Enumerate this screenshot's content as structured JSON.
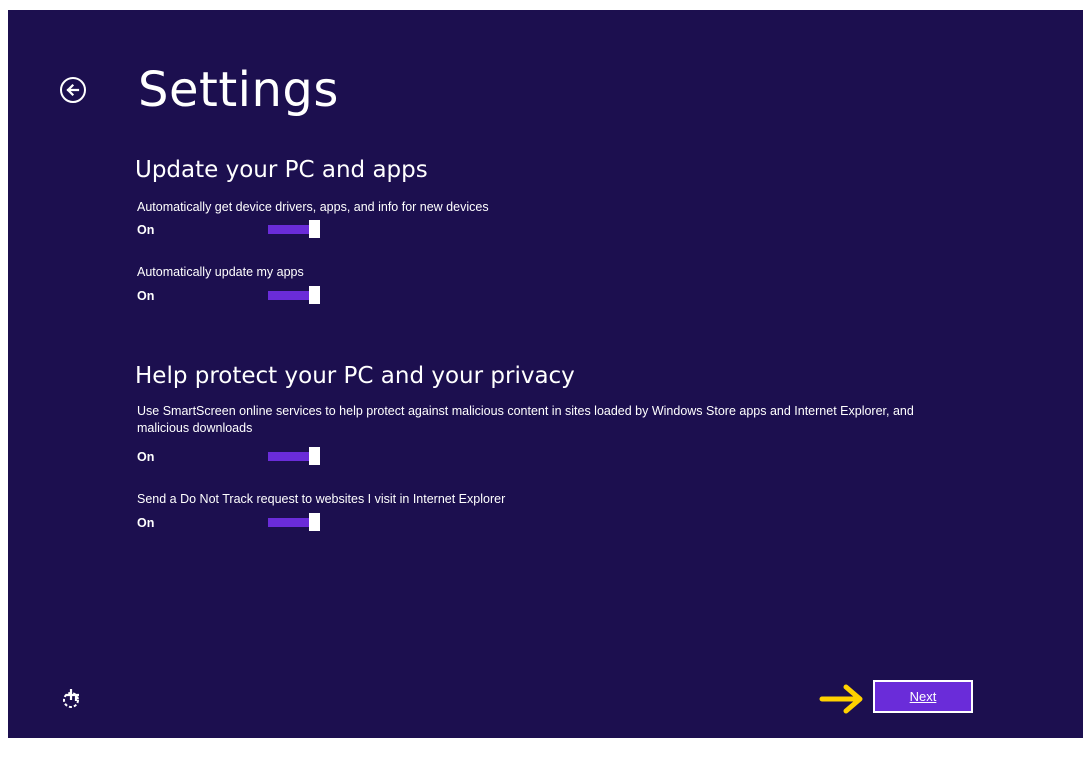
{
  "header": {
    "title": "Settings",
    "back_icon": "back-arrow-circle-icon"
  },
  "sections": [
    {
      "heading": "Update your PC and apps",
      "settings": [
        {
          "description": "Automatically get device drivers, apps, and info for new devices",
          "state": "On"
        },
        {
          "description": "Automatically update my apps",
          "state": "On"
        }
      ]
    },
    {
      "heading": "Help protect your PC and your privacy",
      "settings": [
        {
          "description": "Use SmartScreen online services to help protect against malicious content in sites loaded by Windows Store apps and Internet Explorer, and malicious downloads",
          "state": "On"
        },
        {
          "description": "Send a Do Not Track request to websites I visit in Internet Explorer",
          "state": "On"
        }
      ]
    }
  ],
  "footer": {
    "ease_of_access_icon": "ease-of-access-icon",
    "pointer_icon": "yellow-arrow-icon",
    "next_label": "Next"
  },
  "colors": {
    "background": "#1c0f4f",
    "accent": "#6a2cd9",
    "pointer_arrow": "#ffd200"
  }
}
